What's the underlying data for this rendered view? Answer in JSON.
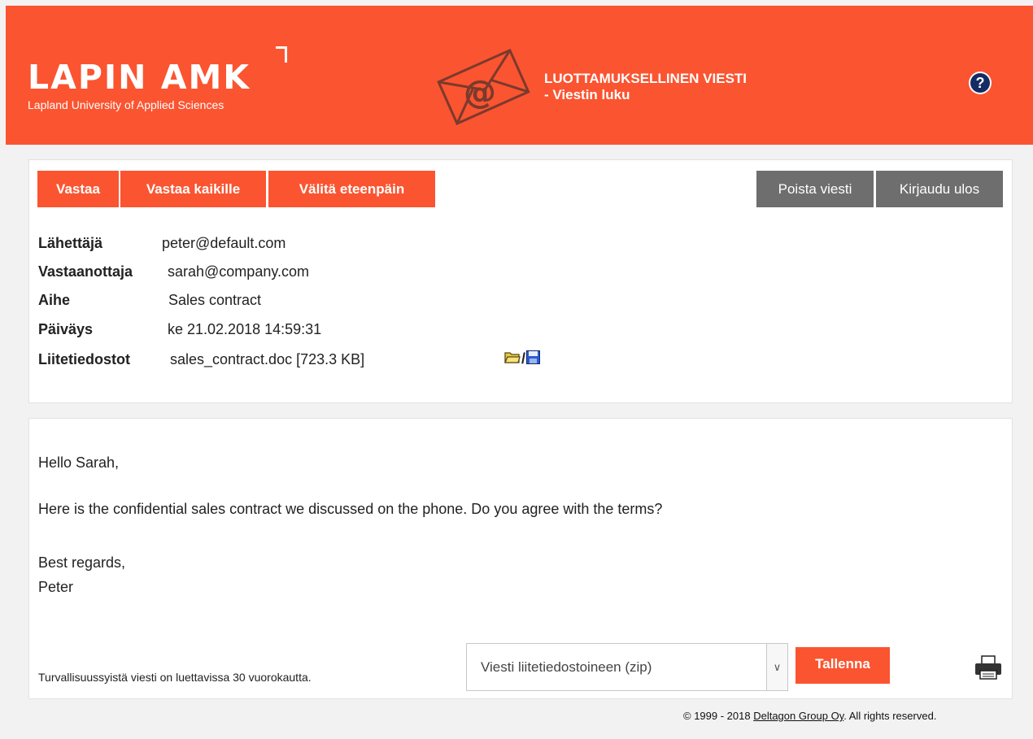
{
  "header": {
    "logo_main": "LAPIN AMK",
    "logo_sub": "Lapland University of Applied Sciences",
    "title_line1": "LUOTTAMUKSELLINEN VIESTI",
    "title_line2": "- Viestin luku",
    "help_symbol": "?",
    "colors": {
      "brand": "#fb5430",
      "help_bg": "#142c63"
    }
  },
  "toolbar": {
    "reply": "Vastaa",
    "reply_all": "Vastaa kaikille",
    "forward": "Välitä eteenpäin",
    "delete": "Poista viesti",
    "logout": "Kirjaudu ulos"
  },
  "meta": {
    "sender_label": "Lähettäjä",
    "sender": "peter@default.com",
    "recipient_label": "Vastaanottaja",
    "recipient": "sarah@company.com",
    "subject_label": "Aihe",
    "subject": "Sales contract",
    "date_label": "Päiväys",
    "date": "ke 21.02.2018 14:59:31",
    "attachments_label": "Liitetiedostot",
    "attachment": "sales_contract.doc [723.3 KB]",
    "attachment_separator": "/",
    "attachment_icons": [
      "open-folder-icon",
      "save-disk-icon"
    ]
  },
  "body": {
    "greeting": "Hello Sarah,",
    "text": "Here is the confidential sales contract we discussed on the phone. Do you agree with the terms?",
    "closing": "Best regards,",
    "signature": "Peter"
  },
  "footer": {
    "note": "Turvallisuussyistä viesti on luettavissa 30 vuorokautta.",
    "select_value": "Viesti liitetiedostoineen (zip)",
    "save": "Tallenna",
    "print_icon": "printer-icon"
  },
  "copyright": {
    "prefix": "© 1999 - 2018 ",
    "link": "Deltagon Group Oy",
    "suffix": ". All rights reserved."
  }
}
